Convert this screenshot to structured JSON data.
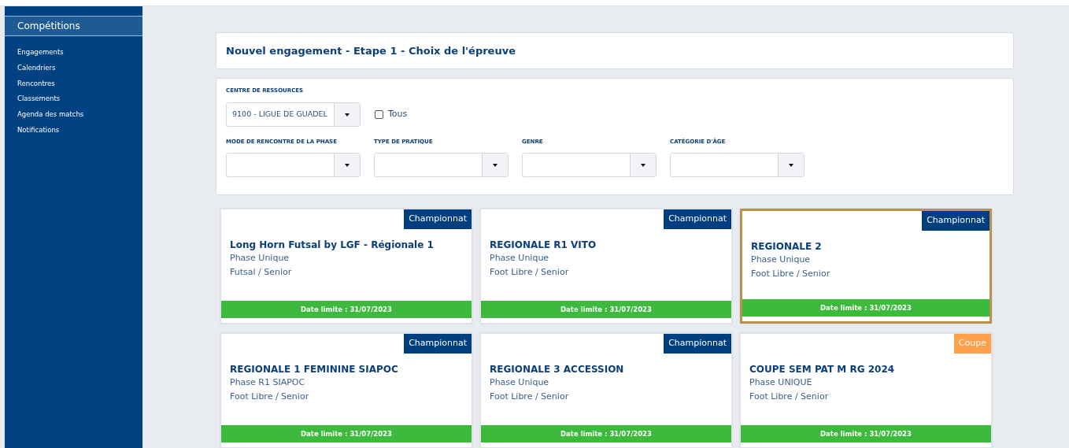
{
  "sidebar": {
    "section": "Compétitions",
    "items": [
      "Engagements",
      "Calendriers",
      "Rencontres",
      "Classements",
      "Agenda des matchs",
      "Notifications"
    ]
  },
  "page_title": "Nouvel engagement - Etape 1 - Choix de l'épreuve",
  "filters": {
    "resource_center": {
      "label": "CENTRE DE RESSOURCES",
      "value": "9100 - LIGUE DE GUADEL"
    },
    "all_checkbox": {
      "label": "Tous",
      "checked": false
    },
    "dropdowns": [
      {
        "label": "MODE DE RENCONTRE DE LA PHASE"
      },
      {
        "label": "TYPE DE PRATIQUE"
      },
      {
        "label": "GENRE"
      },
      {
        "label": "CATÉGORIE D'ÂGE"
      }
    ]
  },
  "cards": [
    {
      "badge": {
        "label": "Championnat",
        "color": "#003f7f"
      },
      "title": "Long Horn Futsal by LGF - Régionale 1",
      "phase": "Phase Unique",
      "practice": "Futsal / Senior",
      "deadline": "Date limite : 31/07/2023",
      "selected": false
    },
    {
      "badge": {
        "label": "Championnat",
        "color": "#003f7f"
      },
      "title": "REGIONALE R1 VITO",
      "phase": "Phase Unique",
      "practice": "Foot Libre / Senior",
      "deadline": "Date limite : 31/07/2023",
      "selected": false
    },
    {
      "badge": {
        "label": "Championnat",
        "color": "#003f7f"
      },
      "title": "REGIONALE 2",
      "phase": "Phase Unique",
      "practice": "Foot Libre / Senior",
      "deadline": "Date limite : 31/07/2023",
      "selected": true
    },
    {
      "badge": {
        "label": "Championnat",
        "color": "#003f7f"
      },
      "title": "REGIONALE 1 FEMININE SIAPOC",
      "phase": "Phase R1 SIAPOC",
      "practice": "Foot Libre / Senior",
      "deadline": "Date limite : 31/07/2023",
      "selected": false
    },
    {
      "badge": {
        "label": "Championnat",
        "color": "#003f7f"
      },
      "title": "REGIONALE 3 ACCESSION",
      "phase": "Phase Unique",
      "practice": "Foot Libre / Senior",
      "deadline": "Date limite : 31/07/2023",
      "selected": false
    },
    {
      "badge": {
        "label": "Coupe",
        "color": "#ffa04a"
      },
      "title": "COUPE SEM PAT M RG 2024",
      "phase": "Phase UNIQUE",
      "practice": "Foot Libre / Senior",
      "deadline": "Date limite : 31/07/2023",
      "selected": false
    }
  ]
}
